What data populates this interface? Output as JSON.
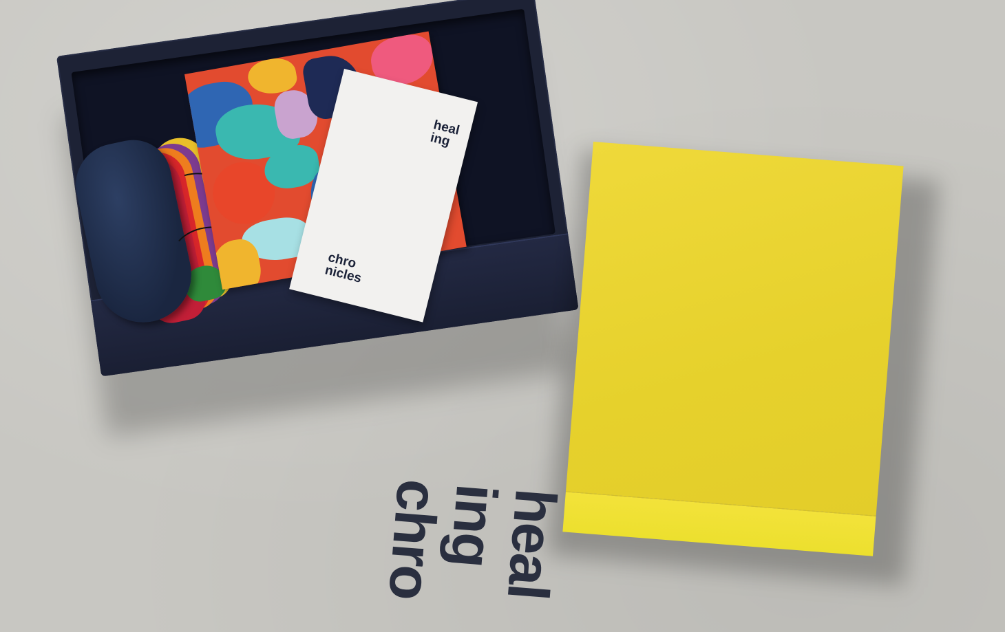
{
  "scene": {
    "background_color": "#c8c7c2",
    "box_color": "#1d2235",
    "lid_color": "#ebd52f",
    "text_color": "#2a2f3f"
  },
  "leaflet": {
    "top_text": "heal\ning",
    "bottom_text": "chro\nnicles"
  },
  "lid": {
    "text": "heal\ning\nchro"
  }
}
